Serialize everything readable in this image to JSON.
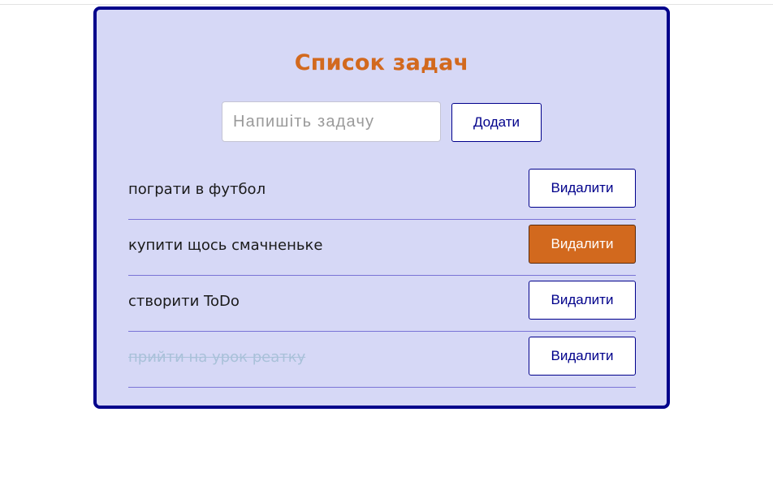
{
  "app": {
    "title": "Список задач",
    "colors": {
      "accent": "#d2691e",
      "border": "#00008b",
      "card_background": "#d6d8f6",
      "divider": "#7a74d6",
      "done_text": "#a9c1d9"
    }
  },
  "form": {
    "placeholder": "Напишіть задачу",
    "value": "",
    "add_label": "Додати"
  },
  "tasks": [
    {
      "text": "пограти в футбол",
      "done": false,
      "delete_label": "Видалити",
      "delete_hovered": false
    },
    {
      "text": "купити щось смачненьке",
      "done": false,
      "delete_label": "Видалити",
      "delete_hovered": true
    },
    {
      "text": "створити ToDo",
      "done": false,
      "delete_label": "Видалити",
      "delete_hovered": false
    },
    {
      "text": "прийти на урок реатку",
      "done": true,
      "delete_label": "Видалити",
      "delete_hovered": false
    }
  ]
}
